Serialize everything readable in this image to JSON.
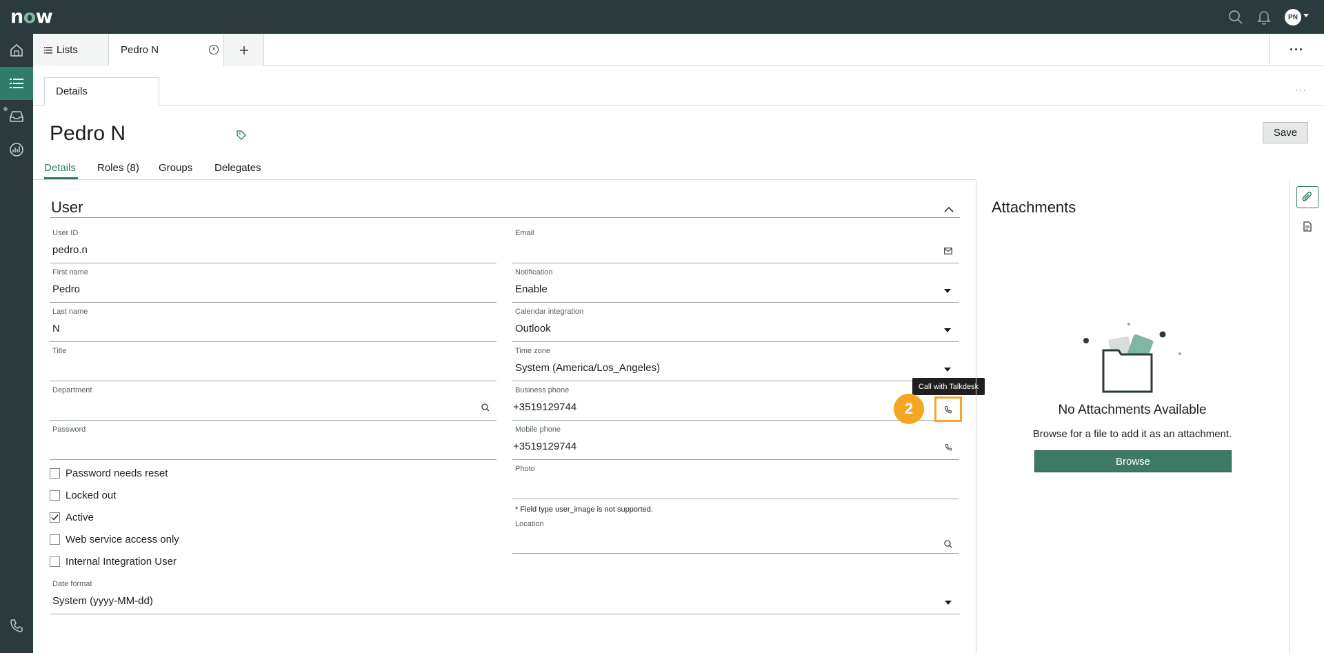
{
  "app": {
    "logo": "now",
    "avatar_initials": "PN"
  },
  "tabs": {
    "lists_label": "Lists",
    "record_label": "Pedro N",
    "more": "···"
  },
  "subtab": {
    "label": "Details",
    "more": "···"
  },
  "record": {
    "title": "Pedro N",
    "save_label": "Save",
    "tabs": [
      "Details",
      "Roles (8)",
      "Groups",
      "Delegates"
    ]
  },
  "section": {
    "title": "User"
  },
  "left_fields": [
    {
      "label": "User ID",
      "value": "pedro.n"
    },
    {
      "label": "First name",
      "value": "Pedro"
    },
    {
      "label": "Last name",
      "value": "N"
    },
    {
      "label": "Title",
      "value": ""
    },
    {
      "label": "Department",
      "value": ""
    },
    {
      "label": "Password",
      "value": ""
    }
  ],
  "right_fields": [
    {
      "label": "Email",
      "value": ""
    },
    {
      "label": "Notification",
      "value": "Enable"
    },
    {
      "label": "Calendar integration",
      "value": "Outlook"
    },
    {
      "label": "Time zone",
      "value": "System (America/Los_Angeles)"
    },
    {
      "label": "Business phone",
      "value": "+3519129744"
    },
    {
      "label": "Mobile phone",
      "value": "+3519129744"
    },
    {
      "label": "Photo",
      "value": ""
    },
    {
      "label": "Location",
      "value": ""
    }
  ],
  "photo_note": "* Field type user_image is not supported.",
  "checkboxes": [
    {
      "label": "Password needs reset",
      "checked": false
    },
    {
      "label": "Locked out",
      "checked": false
    },
    {
      "label": "Active",
      "checked": true
    },
    {
      "label": "Web service access only",
      "checked": false
    },
    {
      "label": "Internal Integration User",
      "checked": false
    }
  ],
  "date_format": {
    "label": "Date format",
    "value": "System (yyyy-MM-dd)"
  },
  "tooltip": "Call with Talkdesk",
  "callout_number": "2",
  "attachments": {
    "title": "Attachments",
    "empty_title": "No Attachments Available",
    "empty_text": "Browse for a file to add it as an attachment.",
    "browse_label": "Browse"
  },
  "colors": {
    "accent": "#2f7d68",
    "topbar": "#2b3b3d",
    "callout": "#f5a623",
    "browse": "#3d7a66"
  }
}
